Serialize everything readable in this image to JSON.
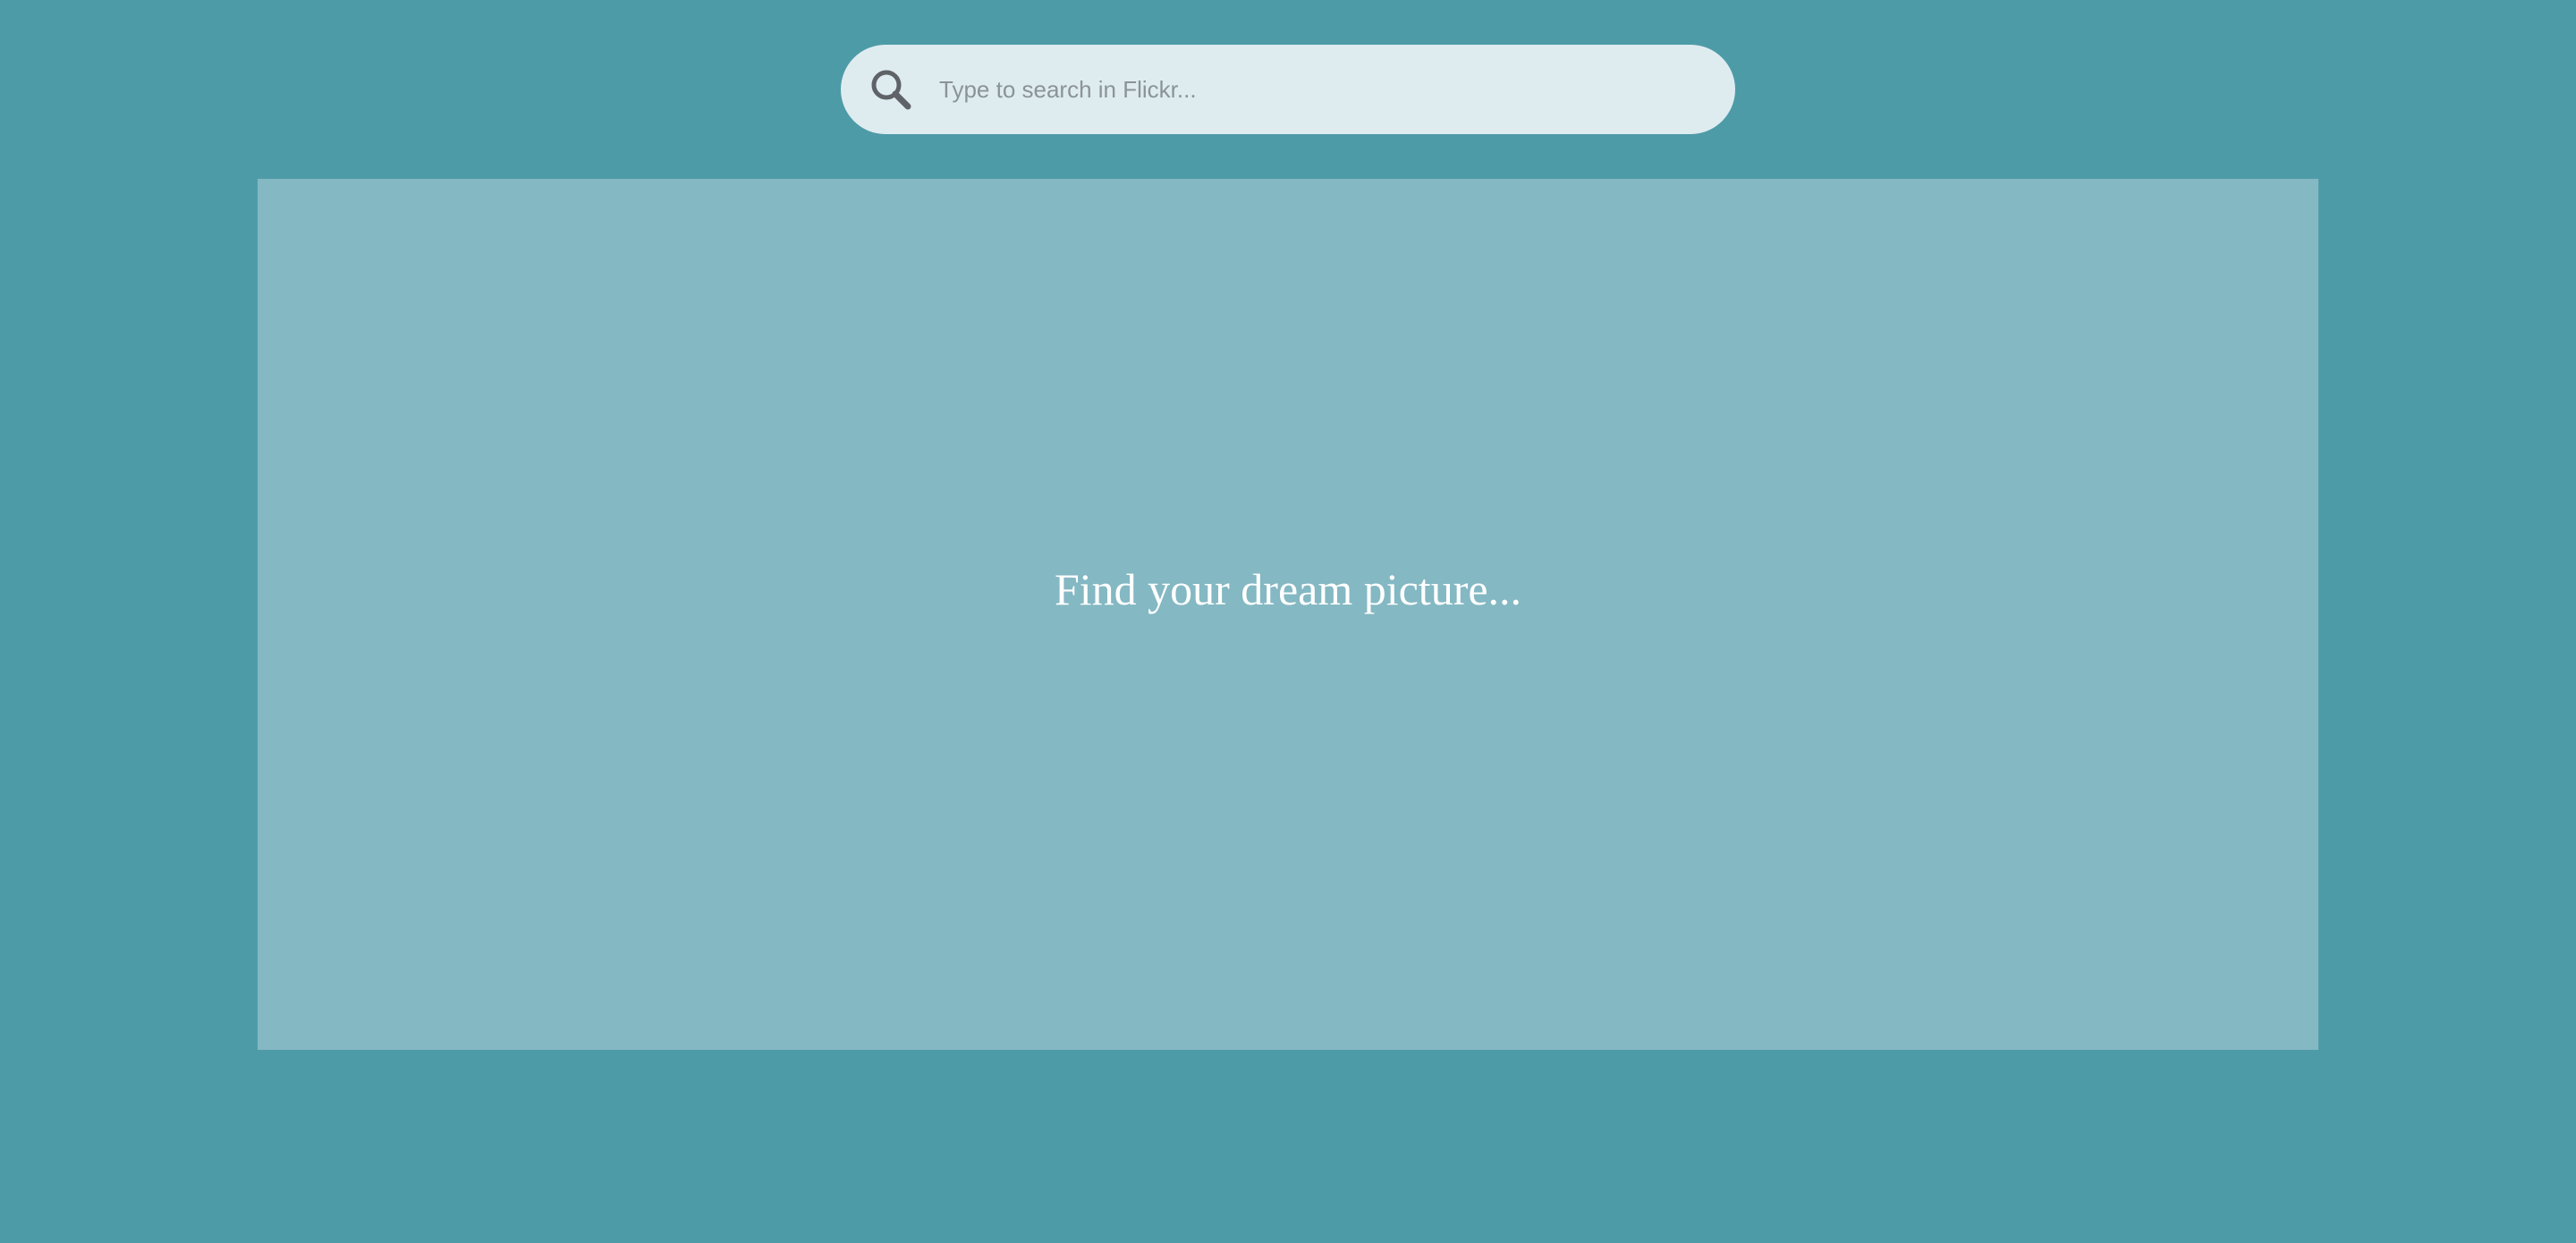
{
  "search": {
    "placeholder": "Type to search in Flickr...",
    "value": "",
    "icon": "search-icon"
  },
  "results": {
    "empty_message": "Find your dream picture..."
  },
  "colors": {
    "background": "#4e9ba8",
    "search_bar": "#deecf0",
    "results_panel": "#84b8c3",
    "icon": "#5f6368"
  }
}
